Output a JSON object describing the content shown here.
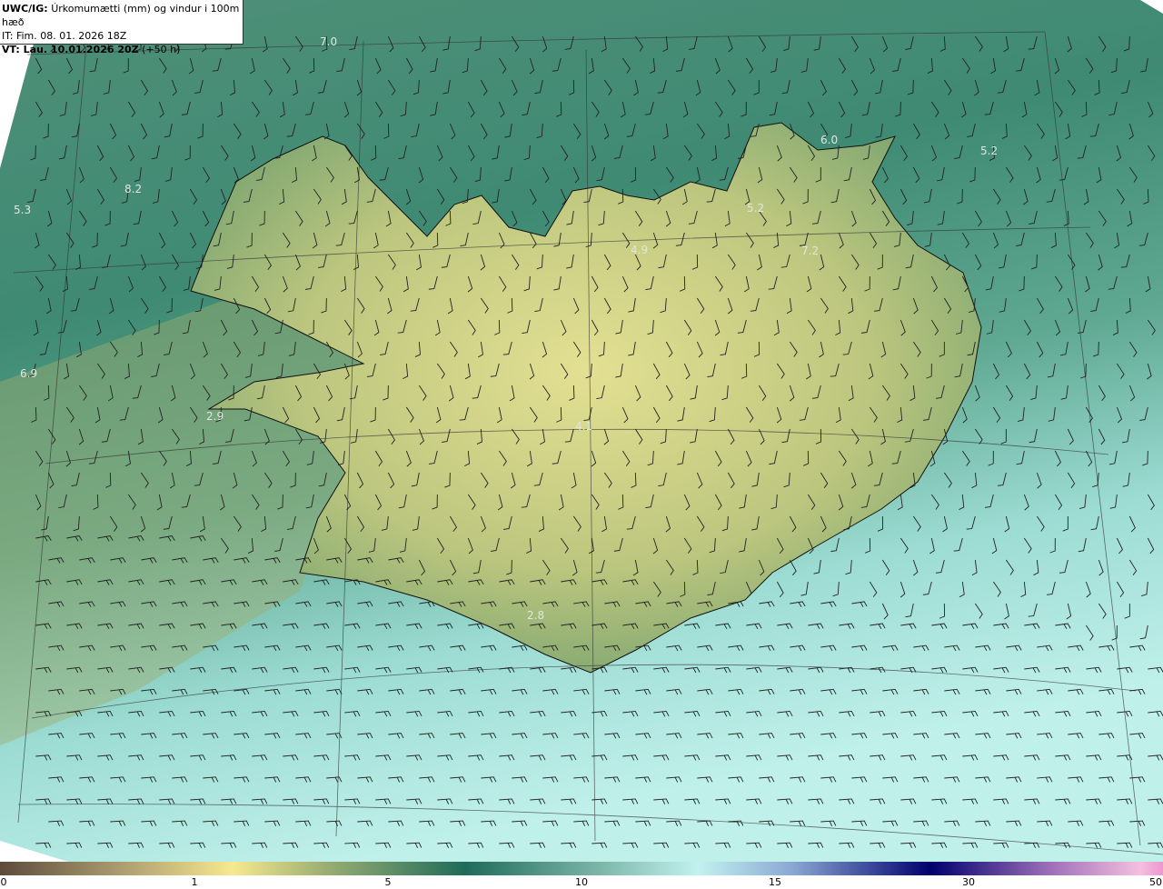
{
  "header": {
    "model": "UWC/IG:",
    "parameter": "Úrkomumætti (mm) og vindur i 100m hæð",
    "initial_time": "IT: Fim. 08. 01. 2026 18Z",
    "valid_time_label": "VT: Lau. 10.01.2026 20Z",
    "lead_time": "(+50 h)"
  },
  "value_labels": [
    "7.0",
    "6.0",
    "5.2",
    "8.2",
    "5.3",
    "5.2",
    "4.9",
    "7.2",
    "6.9",
    "2.9",
    "4.1",
    "2.8"
  ],
  "colorbar": {
    "ticks": [
      "0",
      "1",
      "5",
      "10",
      "15",
      "30",
      "50"
    ],
    "colors": [
      "#5d4b3b",
      "#f6e98e",
      "#1f6b5a",
      "#c2f2ef",
      "#00006e",
      "#f5bfdf",
      "#8a007a"
    ]
  },
  "colors": {
    "land": "#c9cf86",
    "sea_north": "#5e9a80",
    "sea_south": "#b5ece6"
  }
}
